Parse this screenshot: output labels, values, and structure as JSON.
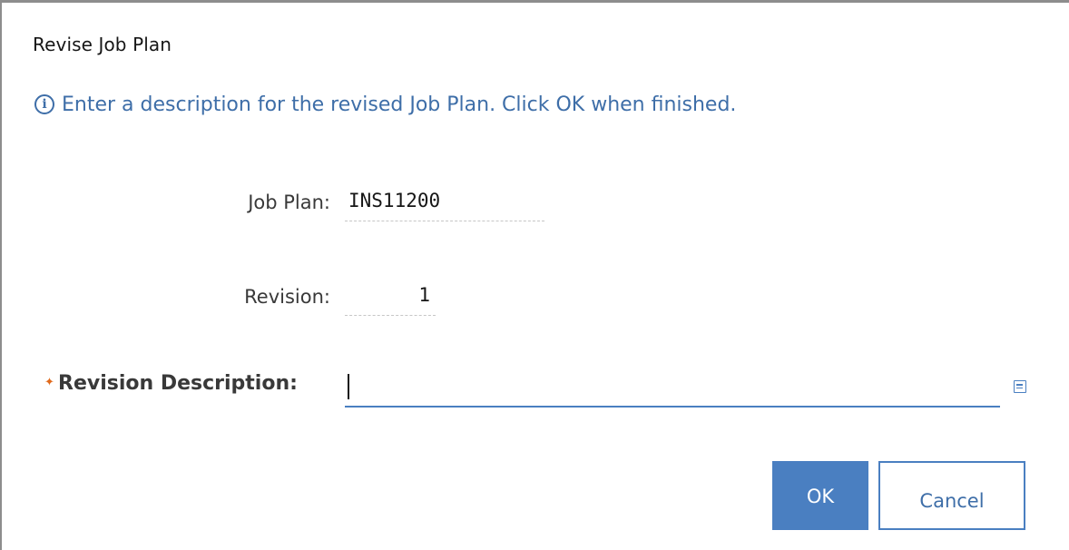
{
  "dialog": {
    "title": "Revise Job Plan",
    "info_icon": "info-icon",
    "info_text": "Enter a description for the revised Job Plan. Click OK when finished."
  },
  "fields": {
    "job_plan": {
      "label": "Job Plan:",
      "value": "INS11200"
    },
    "revision": {
      "label": "Revision:",
      "value": "1"
    },
    "revision_description": {
      "label": "Revision Description:",
      "required_marker": "✦",
      "value": "",
      "long_description_icon": "long-description-icon"
    }
  },
  "buttons": {
    "ok_label": "OK",
    "cancel_label": "Cancel"
  },
  "colors": {
    "accent": "#4a7fc1",
    "info_text": "#3e6ea8",
    "required": "#e06a1c"
  }
}
